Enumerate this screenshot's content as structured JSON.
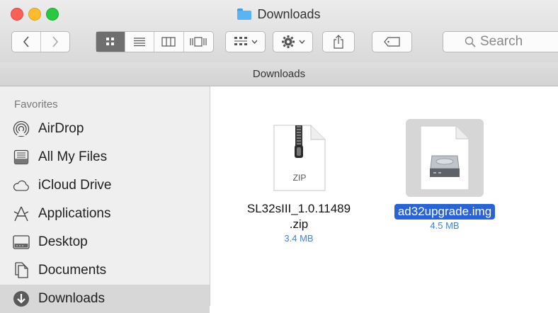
{
  "window": {
    "title": "Downloads",
    "path_label": "Downloads"
  },
  "toolbar": {
    "search_placeholder": "Search",
    "view_modes": [
      "icon",
      "list",
      "column",
      "cover-flow"
    ],
    "active_view": "icon"
  },
  "sidebar": {
    "section_header": "Favorites",
    "items": [
      {
        "label": "AirDrop",
        "icon": "airdrop-icon"
      },
      {
        "label": "All My Files",
        "icon": "all-files-icon"
      },
      {
        "label": "iCloud Drive",
        "icon": "cloud-icon"
      },
      {
        "label": "Applications",
        "icon": "applications-icon"
      },
      {
        "label": "Desktop",
        "icon": "desktop-icon"
      },
      {
        "label": "Documents",
        "icon": "documents-icon"
      },
      {
        "label": "Downloads",
        "icon": "downloads-icon",
        "selected": true
      }
    ]
  },
  "files": [
    {
      "name_line1": "SL32sIII_1.0.11489",
      "name_line2": ".zip",
      "size": "3.4 MB",
      "type_label": "ZIP",
      "selected": false
    },
    {
      "name_line1": "ad32upgrade.img",
      "size": "4.5 MB",
      "selected": true
    }
  ],
  "colors": {
    "selection_blue": "#2a63d3",
    "size_text_blue": "#4a7fd1",
    "folder_blue": "#5ab3f2"
  }
}
